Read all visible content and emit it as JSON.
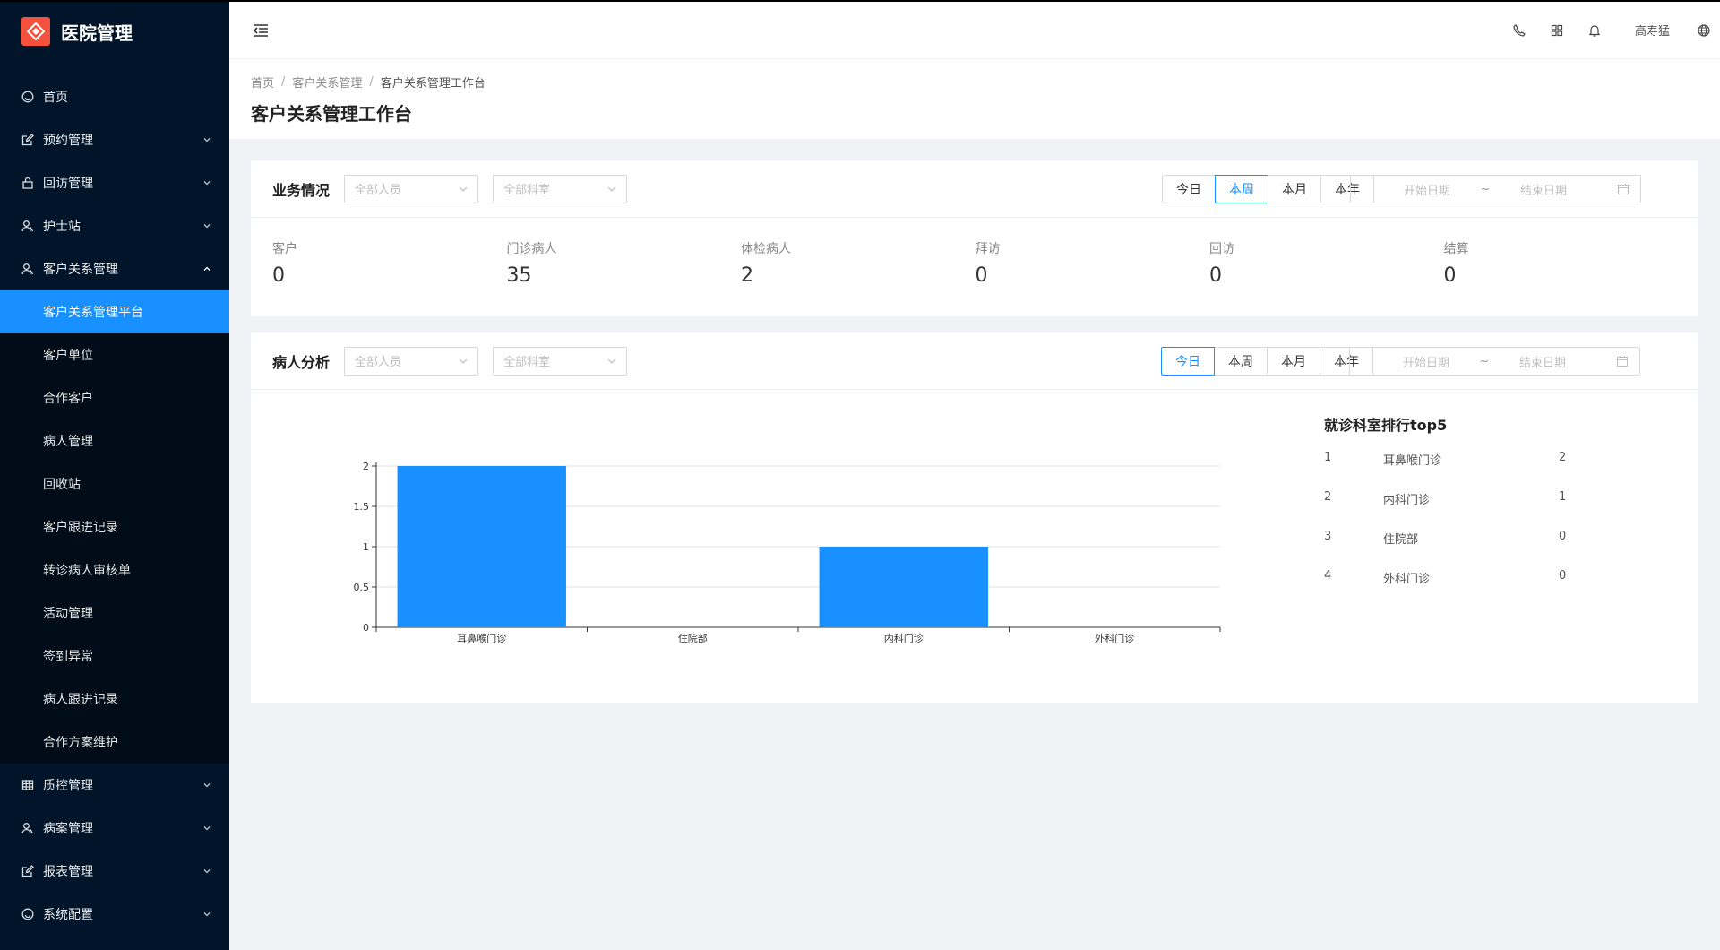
{
  "app": {
    "title": "医院管理"
  },
  "sidebar": {
    "items_before": [
      {
        "label": "首页",
        "icon": "dashboard-icon",
        "has_arrow": false
      },
      {
        "label": "预约管理",
        "icon": "edit-icon",
        "has_arrow": true
      },
      {
        "label": "回访管理",
        "icon": "lock-icon",
        "has_arrow": true
      },
      {
        "label": "护士站",
        "icon": "user-icon",
        "has_arrow": true
      },
      {
        "label": "客户关系管理",
        "icon": "user-icon",
        "has_arrow": true,
        "expanded": true
      }
    ],
    "sub_items": [
      {
        "label": "客户关系管理平台",
        "active": true
      },
      {
        "label": "客户单位"
      },
      {
        "label": "合作客户"
      },
      {
        "label": "病人管理"
      },
      {
        "label": "回收站"
      },
      {
        "label": "客户跟进记录"
      },
      {
        "label": "转诊病人审核单"
      },
      {
        "label": "活动管理"
      },
      {
        "label": "签到异常"
      },
      {
        "label": "病人跟进记录"
      },
      {
        "label": "合作方案维护"
      }
    ],
    "items_after": [
      {
        "label": "质控管理",
        "icon": "table-icon",
        "has_arrow": true
      },
      {
        "label": "病案管理",
        "icon": "user-icon",
        "has_arrow": true
      },
      {
        "label": "报表管理",
        "icon": "edit-icon",
        "has_arrow": true
      },
      {
        "label": "系统配置",
        "icon": "dashboard-icon",
        "has_arrow": true
      }
    ]
  },
  "header": {
    "icons": [
      "phone-icon",
      "apps-icon",
      "bell-icon"
    ],
    "username": "高寿猛",
    "language_icon": "globe-icon"
  },
  "breadcrumb": [
    "首页",
    "客户关系管理",
    "客户关系管理工作台"
  ],
  "page_title": "客户关系管理工作台",
  "business": {
    "title": "业务情况",
    "person_select": "全部人员",
    "dept_select": "全部科室",
    "periods": [
      "今日",
      "本周",
      "本月",
      "本年"
    ],
    "active_period": "本周",
    "start_placeholder": "开始日期",
    "range_sep": "~",
    "end_placeholder": "结束日期",
    "stats": [
      {
        "label": "客户",
        "value": "0"
      },
      {
        "label": "门诊病人",
        "value": "35"
      },
      {
        "label": "体检病人",
        "value": "2"
      },
      {
        "label": "拜访",
        "value": "0"
      },
      {
        "label": "回访",
        "value": "0"
      },
      {
        "label": "结算",
        "value": "0"
      }
    ]
  },
  "patients": {
    "title": "病人分析",
    "person_select": "全部人员",
    "dept_select": "全部科室",
    "periods": [
      "今日",
      "本周",
      "本月",
      "本年"
    ],
    "active_period": "今日",
    "start_placeholder": "开始日期",
    "range_sep": "~",
    "end_placeholder": "结束日期",
    "ranking_title": "就诊科室排行top5",
    "ranking": [
      {
        "rank": "1",
        "name": "耳鼻喉门诊",
        "count": "2"
      },
      {
        "rank": "2",
        "name": "内科门诊",
        "count": "1"
      },
      {
        "rank": "3",
        "name": "住院部",
        "count": "0"
      },
      {
        "rank": "4",
        "name": "外科门诊",
        "count": "0"
      }
    ]
  },
  "chart_data": {
    "type": "bar",
    "categories": [
      "耳鼻喉门诊",
      "住院部",
      "内科门诊",
      "外科门诊"
    ],
    "values": [
      2,
      0,
      1,
      0
    ],
    "ylim": [
      0,
      2
    ],
    "yticks": [
      "0",
      "0.5",
      "1",
      "1.5",
      "2"
    ],
    "grid": true,
    "color": "#1890ff"
  },
  "colors": {
    "sidebar_bg": "#001529",
    "accent": "#1890ff",
    "logo": "#f5513d"
  }
}
